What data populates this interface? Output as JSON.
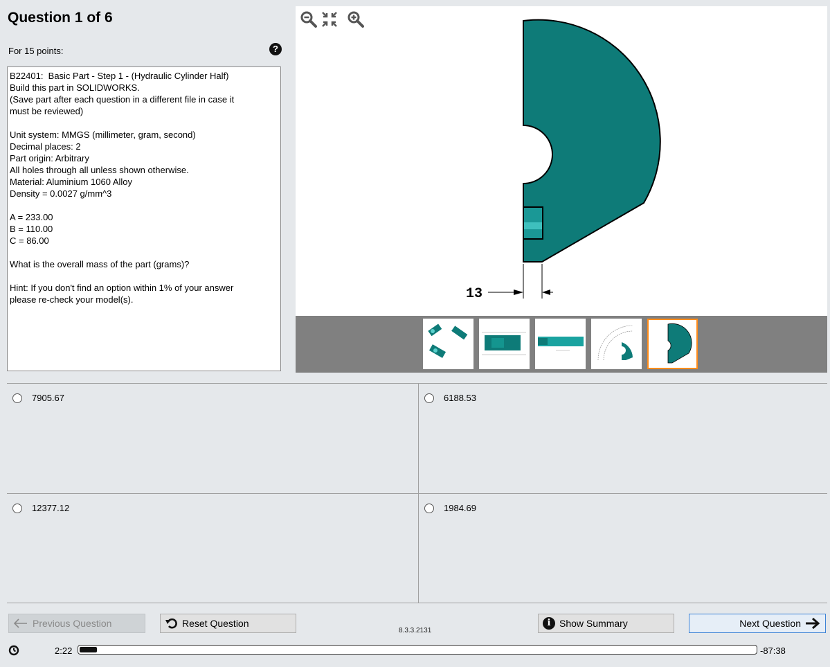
{
  "question": {
    "title": "Question 1 of 6",
    "points": "For 15 points:",
    "help_icon": "question-circle-icon",
    "text_paragraphs": [
      [
        "B22401:  Basic Part - Step 1 - (Hydraulic Cylinder Half)",
        "Build this part in SOLIDWORKS.",
        "(Save part after each question in a different file in case it",
        "must be reviewed)"
      ],
      [
        "Unit system: MMGS (millimeter, gram, second)",
        "Decimal places: 2",
        "Part origin: Arbitrary",
        "All holes through all unless shown otherwise.",
        "Material: Aluminium 1060 Alloy",
        "Density = 0.0027 g/mm^3"
      ],
      [
        "A = 233.00",
        "B = 110.00",
        "C = 86.00"
      ],
      [
        "What is the overall mass of the part (grams)?"
      ],
      [
        "Hint: If you don't find an option within 1% of your answer",
        "please re-check your model(s)."
      ]
    ]
  },
  "viewer": {
    "zoom_out_icon": "zoom-out-icon",
    "fit_icon": "fit-to-window-icon",
    "zoom_in_icon": "zoom-in-icon",
    "dimension_label": "13",
    "part_color": "#0e7b78",
    "thumbnails": [
      {
        "name": "thumbnail-isometric-views",
        "selected": false
      },
      {
        "name": "thumbnail-side-view",
        "selected": false
      },
      {
        "name": "thumbnail-top-view",
        "selected": false
      },
      {
        "name": "thumbnail-drawing-view",
        "selected": false
      },
      {
        "name": "thumbnail-front-detail",
        "selected": true
      }
    ],
    "selected_border_color": "#ff8c1a"
  },
  "answers": [
    {
      "label": "7905.67"
    },
    {
      "label": "6188.53"
    },
    {
      "label": "12377.12"
    },
    {
      "label": "1984.69"
    }
  ],
  "footer": {
    "prev_label": "Previous Question",
    "reset_label": "Reset Question",
    "summary_label": "Show Summary",
    "next_label": "Next Question",
    "version": "8.3.3.2131",
    "elapsed": "2:22",
    "remaining": "-87:38",
    "progress_fraction": 0.026
  }
}
